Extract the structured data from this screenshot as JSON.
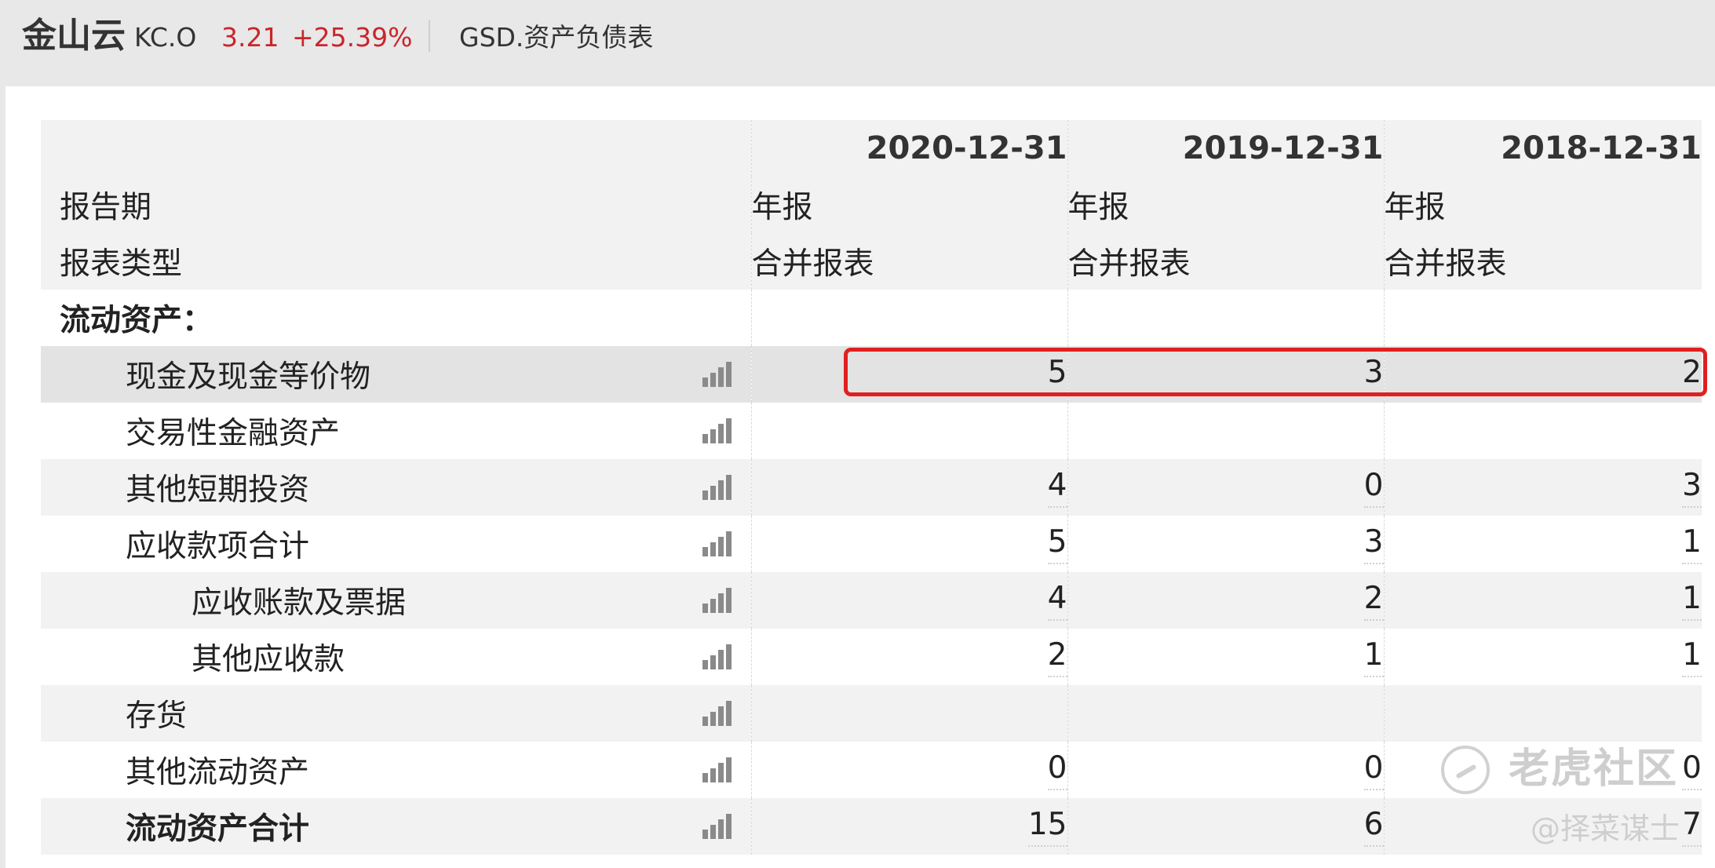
{
  "header": {
    "company_name": "金山云",
    "ticker": "KC.O",
    "price": "3.21",
    "change_pct": "+25.39%",
    "tab_label": "GSD.资产负债表"
  },
  "table": {
    "period_headers": [
      "2020-12-31",
      "2019-12-31",
      "2018-12-31"
    ],
    "rows": [
      {
        "label": "报告期",
        "values": [
          "年报",
          "年报",
          "年报"
        ],
        "chart_icon": false
      },
      {
        "label": "报表类型",
        "values": [
          "合并报表",
          "合并报表",
          "合并报表"
        ],
        "chart_icon": false
      },
      {
        "label": "流动资产：",
        "values": [
          "",
          "",
          ""
        ],
        "chart_icon": false
      },
      {
        "label": "现金及现金等价物",
        "values": [
          "5",
          "3",
          "2"
        ],
        "chart_icon": true,
        "highlighted": true
      },
      {
        "label": "交易性金融资产",
        "values": [
          "",
          "",
          ""
        ],
        "chart_icon": true
      },
      {
        "label": "其他短期投资",
        "values": [
          "4",
          "0",
          "3"
        ],
        "chart_icon": true
      },
      {
        "label": "应收款项合计",
        "values": [
          "5",
          "3",
          "1"
        ],
        "chart_icon": true
      },
      {
        "label": "应收账款及票据",
        "values": [
          "4",
          "2",
          "1"
        ],
        "chart_icon": true
      },
      {
        "label": "其他应收款",
        "values": [
          "2",
          "1",
          "1"
        ],
        "chart_icon": true
      },
      {
        "label": "存货",
        "values": [
          "",
          "",
          ""
        ],
        "chart_icon": true
      },
      {
        "label": "其他流动资产",
        "values": [
          "0",
          "0",
          "0"
        ],
        "chart_icon": true
      },
      {
        "label": "流动资产合计",
        "values": [
          "15",
          "6",
          "7"
        ],
        "chart_icon": true
      }
    ]
  },
  "icons": {
    "chart": "bar-chart-icon"
  },
  "colors": {
    "price_up": "#c9252b",
    "highlight_border": "#e02020"
  },
  "watermark": {
    "brand": "老虎社区",
    "author": "@择菜谋士"
  }
}
